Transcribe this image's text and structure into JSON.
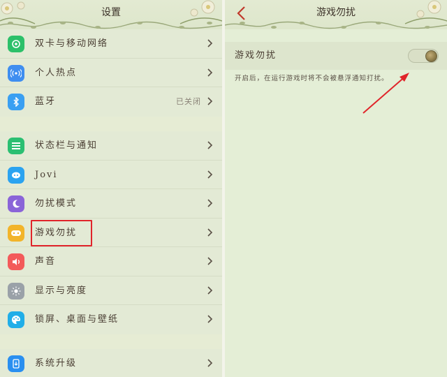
{
  "left_screen": {
    "header": {
      "title": "设置"
    },
    "groups": [
      {
        "items": [
          {
            "label": "双卡与移动网络",
            "value": "",
            "icon": "network-icon",
            "color": "#2cc069"
          },
          {
            "label": "个人热点",
            "value": "",
            "icon": "hotspot-icon",
            "color": "#3f8ef0"
          },
          {
            "label": "蓝牙",
            "value": "已关闭",
            "icon": "bluetooth-icon",
            "color": "#3a9ff2"
          }
        ]
      },
      {
        "items": [
          {
            "label": "状态栏与通知",
            "value": "",
            "icon": "notification-bar-icon",
            "color": "#2bbf72"
          },
          {
            "label": "Jovi",
            "value": "",
            "icon": "jovi-icon",
            "color": "#2ba3f0"
          },
          {
            "label": "勿扰模式",
            "value": "",
            "icon": "moon-icon",
            "color": "#8a64d8"
          },
          {
            "label": "游戏勿扰",
            "value": "",
            "icon": "gamepad-icon",
            "color": "#f2b42a"
          },
          {
            "label": "声音",
            "value": "",
            "icon": "speaker-icon",
            "color": "#f35a5a"
          },
          {
            "label": "显示与亮度",
            "value": "",
            "icon": "brightness-icon",
            "color": "#9aa1a8"
          },
          {
            "label": "锁屏、桌面与壁纸",
            "value": "",
            "icon": "palette-icon",
            "color": "#21aee8"
          }
        ]
      },
      {
        "items": [
          {
            "label": "系统升级",
            "value": "",
            "icon": "system-update-icon",
            "color": "#2a8ff0"
          }
        ]
      }
    ]
  },
  "right_screen": {
    "header": {
      "title": "游戏勿扰"
    },
    "setting": {
      "label": "游戏勿扰",
      "enabled": true
    },
    "description": "开启后，在运行游戏时将不会被悬浮通知打扰。"
  },
  "annotations": {
    "highlight_color": "#e0242a"
  }
}
